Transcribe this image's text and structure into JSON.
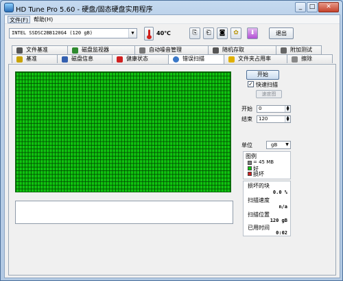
{
  "window": {
    "title": "HD Tune Pro 5.60 - 硬盘/固态硬盘实用程序"
  },
  "menu": [
    {
      "label": "文件(F)"
    },
    {
      "label": "帮助(H)"
    }
  ],
  "toolbar": {
    "drive": "INTEL SSDSC2BB120G4 (120 gB)",
    "temperature": "40℃",
    "buttons": [
      {
        "icon": "copy-icon"
      },
      {
        "icon": "copy-all-icon"
      },
      {
        "icon": "camera-icon"
      },
      {
        "icon": "options-icon"
      },
      {
        "icon": "download-icon"
      }
    ],
    "exit_label": "退出"
  },
  "tabs_row1": [
    {
      "label": "文件基准",
      "icon": "file-benchmark-icon",
      "color": "#555555"
    },
    {
      "label": "磁盘监视器",
      "icon": "disk-monitor-icon",
      "color": "#2f8a2f"
    },
    {
      "label": "自动噪音管理",
      "icon": "speaker-icon",
      "color": "#777777"
    },
    {
      "label": "随机存取",
      "icon": "random-access-icon",
      "color": "#555555"
    },
    {
      "label": "附加测试",
      "icon": "extra-tests-icon",
      "color": "#666666"
    }
  ],
  "tabs_row2": [
    {
      "label": "基准",
      "icon": "benchmark-icon",
      "color": "#c9a300"
    },
    {
      "label": "磁盘信息",
      "icon": "info-icon",
      "color": "#3460b0"
    },
    {
      "label": "健康状态",
      "icon": "health-icon",
      "color": "#d02020"
    },
    {
      "label": "错误扫描",
      "icon": "error-scan-icon",
      "color": "#3a78c8",
      "active": true
    },
    {
      "label": "文件夹占用率",
      "icon": "folder-icon",
      "color": "#e0b000"
    },
    {
      "label": "擦除",
      "icon": "erase-icon",
      "color": "#888888"
    }
  ],
  "scan": {
    "start_label": "开始",
    "quick_scan_label": "快速扫描",
    "quick_scan_checked": "✓",
    "speed_map_label": "速度图",
    "start_pos_label": "开始",
    "start_pos_value": "0",
    "end_pos_label": "结束",
    "end_pos_value": "120",
    "unit_label": "单位",
    "unit_value": "gB",
    "legend_title": "图例",
    "legend_block": "= 45 MB",
    "legend_good": "好",
    "legend_bad": "损坏",
    "legend_block_color": "#808080",
    "legend_good_color": "#10c510",
    "legend_bad_color": "#d02020",
    "bad_blocks_label": "损坏的块",
    "bad_blocks_value": "0.0 %",
    "speed_label": "扫描速度",
    "speed_value": "n/a",
    "position_label": "扫描位置",
    "position_value": "120 gB",
    "elapsed_label": "已用时间",
    "elapsed_value": "0:02"
  }
}
